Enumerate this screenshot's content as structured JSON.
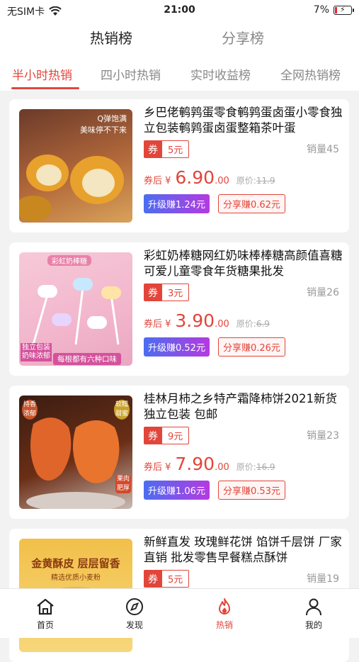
{
  "status": {
    "carrier": "无SIM卡",
    "time": "21:00",
    "battery": "7%"
  },
  "main_tabs": [
    {
      "label": "热销榜"
    },
    {
      "label": "分享榜"
    }
  ],
  "sub_tabs": [
    {
      "label": "半小时热销"
    },
    {
      "label": "四小时热销"
    },
    {
      "label": "实时收益榜"
    },
    {
      "label": "全网热销榜"
    }
  ],
  "products": [
    {
      "title": "乡巴佬鹌鹑蛋零食鹌鹑蛋卤蛋小零食独立包装鹌鹑蛋卤蛋整箱茶叶蛋",
      "coupon_key": "券",
      "coupon_value": "5元",
      "sales": "销量45",
      "price_label": "券后 ¥",
      "price_int": "6.90",
      "price_dec": ".00",
      "orig_label": "原价:",
      "orig_price": "11.9",
      "upgrade": "升级赚1.24元",
      "share": "分享赚0.62元",
      "img_text1": "Q弹饱满",
      "img_text2": "美味停不下来"
    },
    {
      "title": "彩虹奶棒糖网红奶味棒棒糖高颜值喜糖可爱儿童零食年货糖果批发",
      "coupon_key": "券",
      "coupon_value": "3元",
      "sales": "销量26",
      "price_label": "券后 ¥",
      "price_int": "3.90",
      "price_dec": ".00",
      "orig_label": "原价:",
      "orig_price": "6.9",
      "upgrade": "升级赚0.52元",
      "share": "分享赚0.26元",
      "img_text1": "彩虹奶棒糖",
      "img_text2": "独立包装 奶味浓郁",
      "img_text3": "每根都有六种口味"
    },
    {
      "title": "桂林月柿之乡特产霜降柿饼2021新货独立包装 包邮",
      "coupon_key": "券",
      "coupon_value": "9元",
      "sales": "销量23",
      "price_label": "券后 ¥",
      "price_int": "7.90",
      "price_dec": ".00",
      "orig_label": "原价:",
      "orig_price": "16.9",
      "upgrade": "升级赚1.06元",
      "share": "分享赚0.53元",
      "img_text1": "持香浓郁",
      "img_text2": "软糯甜蜜",
      "img_text3": "果肉肥厚"
    },
    {
      "title": "新鲜直发 玫瑰鲜花饼 馅饼千层饼 厂家直销 批发零售早餐糕点酥饼",
      "coupon_key": "券",
      "coupon_value": "5元",
      "sales": "销量19",
      "img_text1": "金黄酥皮 层层留香",
      "img_text2": "精选优质小麦粉"
    }
  ],
  "nav": [
    {
      "label": "首页"
    },
    {
      "label": "发现"
    },
    {
      "label": "热销"
    },
    {
      "label": "我的"
    }
  ],
  "colors": {
    "accent": "#e2453a"
  }
}
